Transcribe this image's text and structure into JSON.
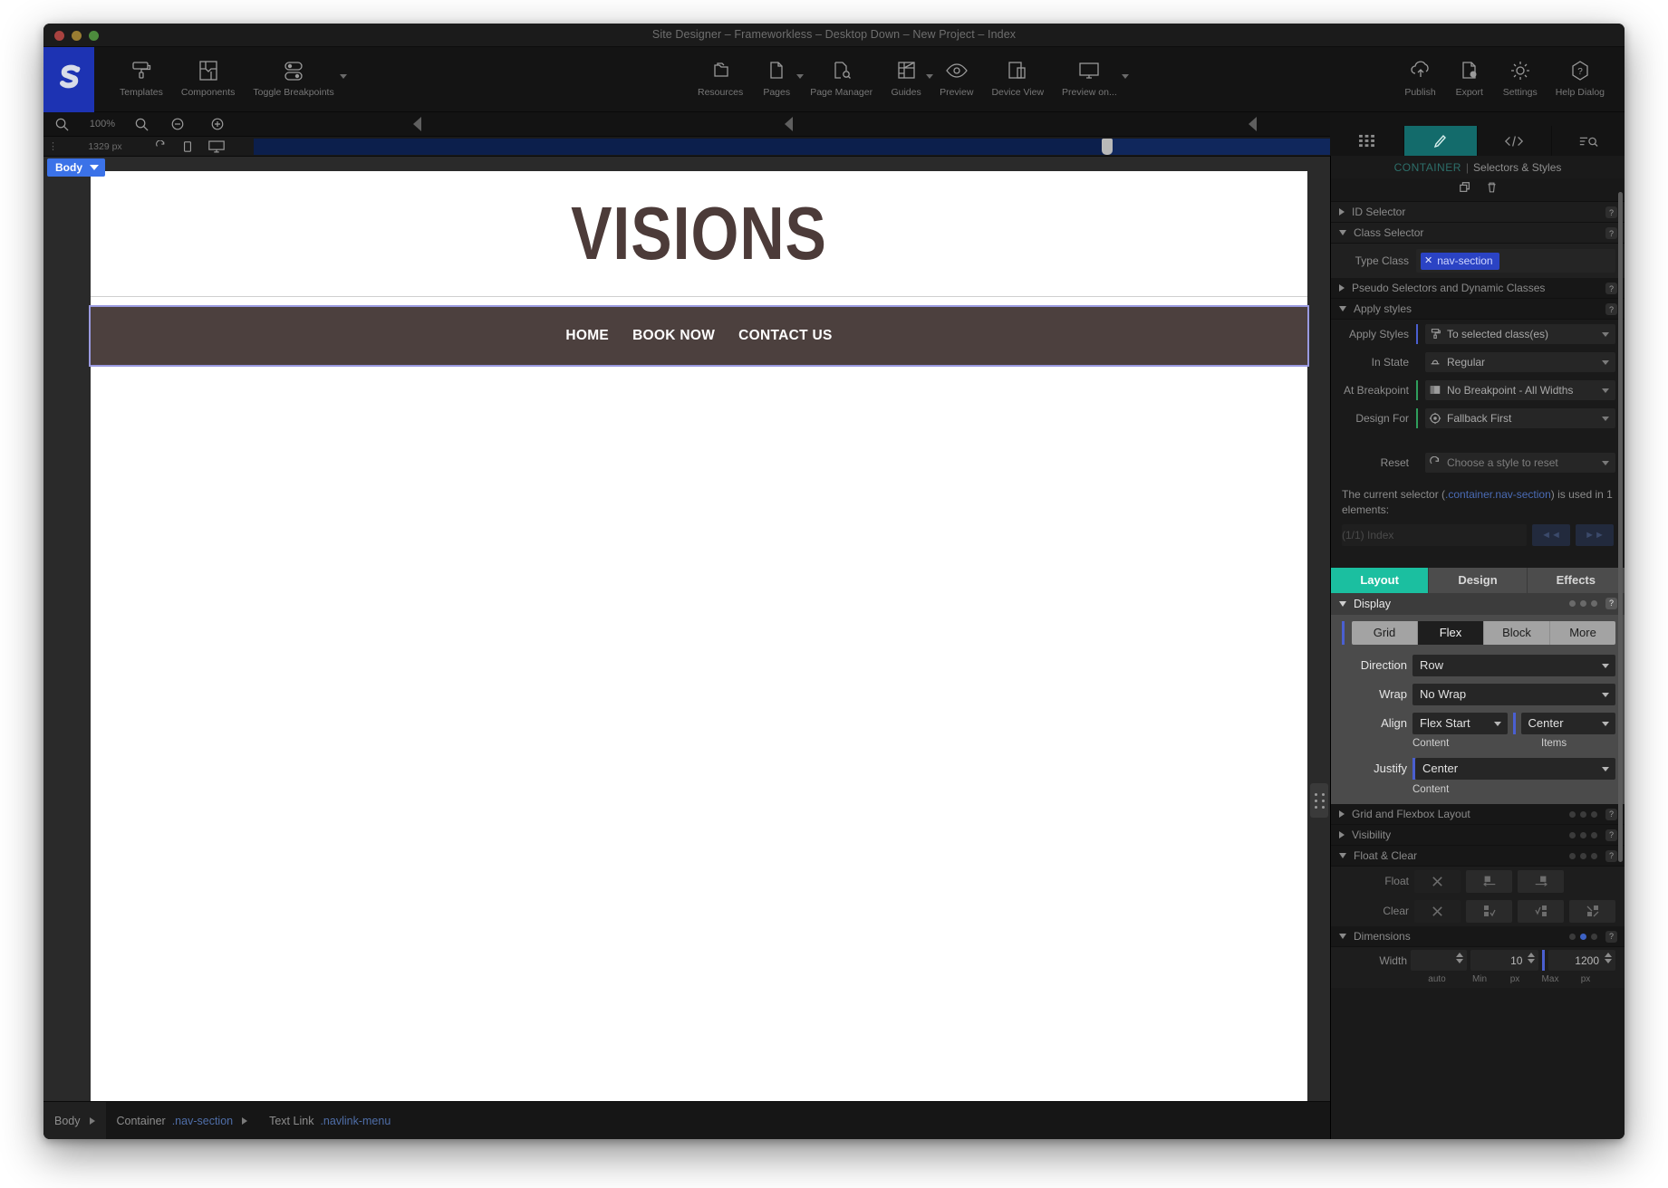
{
  "window": {
    "title": "Site Designer – Frameworkless – Desktop Down – New Project – Index"
  },
  "toolbar": {
    "left": [
      {
        "label": "Templates",
        "icon": "paint-roller-icon",
        "caret": false
      },
      {
        "label": "Components",
        "icon": "components-icon",
        "caret": false
      },
      {
        "label": "Toggle Breakpoints",
        "icon": "toggle-breakpoints-icon",
        "caret": true
      }
    ],
    "center": [
      {
        "label": "Resources",
        "icon": "folders-icon",
        "caret": false
      },
      {
        "label": "Pages",
        "icon": "pages-icon",
        "caret": true
      },
      {
        "label": "Page Manager",
        "icon": "page-manager-icon",
        "caret": false
      },
      {
        "label": "Guides",
        "icon": "guides-icon",
        "caret": true
      },
      {
        "label": "Preview",
        "icon": "eye-icon",
        "caret": false
      },
      {
        "label": "Device View",
        "icon": "device-view-icon",
        "caret": false
      },
      {
        "label": "Preview on...",
        "icon": "monitor-icon",
        "caret": true
      }
    ],
    "right": [
      {
        "label": "Publish",
        "icon": "cloud-upload-icon",
        "caret": false
      },
      {
        "label": "Export",
        "icon": "export-file-icon",
        "caret": false
      },
      {
        "label": "Settings",
        "icon": "gear-icon",
        "caret": false
      },
      {
        "label": "Help Dialog",
        "icon": "help-hexagon-icon",
        "caret": false
      }
    ]
  },
  "zoombar": {
    "zoom_level": "100%",
    "zoom_out_icon": "magnifier-minus-icon",
    "zoom_in_icon": "magnifier-plus-icon",
    "minus_icon": "minus-circle-icon",
    "plus_icon": "plus-circle-icon",
    "collapse_icon": "collapse-left-icon"
  },
  "breakpointbar": {
    "width_value": "1329 px",
    "handle_icon": "breakpoint-handle-icon",
    "icons": [
      "reset-icon",
      "tablet-icon",
      "desktop-icon"
    ]
  },
  "canvas": {
    "body_tag": "Body",
    "hero_title": "VISIONS",
    "nav_links": [
      "HOME",
      "BOOK NOW",
      "CONTACT US"
    ],
    "nav_bg_color": "#4c403e",
    "hero_text_color": "#4c3b39",
    "selection_outline_color": "#9a9ae0"
  },
  "statusbar": {
    "crumbs": [
      {
        "name": "Body",
        "sub": "",
        "selected": true
      },
      {
        "name": "Container",
        "sub": ".nav-section",
        "selected": false
      },
      {
        "name": "Text Link",
        "sub": ".navlink-menu",
        "selected": false
      }
    ]
  },
  "rightpanel": {
    "tabs": [
      {
        "icon": "grid-blocks-icon",
        "active": false
      },
      {
        "icon": "paint-brush-icon",
        "active": true
      },
      {
        "icon": "code-icon",
        "active": false
      },
      {
        "icon": "list-search-icon",
        "active": false
      }
    ],
    "header": {
      "element": "CONTAINER",
      "separator": "|",
      "title": "Selectors & Styles"
    },
    "header_icons": [
      "duplicate-icon",
      "trash-icon"
    ],
    "sections": {
      "id_selector": "ID Selector",
      "class_selector": "Class Selector",
      "type_class_label": "Type Class",
      "type_class_chip": "nav-section",
      "pseudo_selectors": "Pseudo Selectors and Dynamic Classes",
      "apply_styles": "Apply styles"
    },
    "apply": [
      {
        "label": "Apply Styles",
        "value": "To selected class(es)",
        "icon": "roller-icon",
        "bar": "blue"
      },
      {
        "label": "In State",
        "value": "Regular",
        "icon": "state-icon",
        "bar": "none"
      },
      {
        "label": "At Breakpoint",
        "value": "No Breakpoint - All Widths",
        "icon": "breakpoint-icon",
        "bar": "green"
      },
      {
        "label": "Design For",
        "value": "Fallback First",
        "icon": "target-icon",
        "bar": "green"
      }
    ],
    "reset": {
      "label": "Reset",
      "placeholder": "Choose a style to reset",
      "icon": "reset-circle-icon"
    },
    "usage": {
      "text_before": "The current selector (",
      "selector": ".container.nav-section",
      "text_after": ") is used in 1 elements:",
      "dropdown_value": "(1/1) Index",
      "prev_label": "◄◄",
      "next_label": "►►"
    },
    "lde_tabs": [
      {
        "label": "Layout",
        "active": true
      },
      {
        "label": "Design",
        "active": false
      },
      {
        "label": "Effects",
        "active": false
      }
    ],
    "display": {
      "title": "Display",
      "segments": [
        {
          "label": "Grid",
          "active": false
        },
        {
          "label": "Flex",
          "active": true
        },
        {
          "label": "Block",
          "active": false
        },
        {
          "label": "More",
          "active": false
        }
      ],
      "direction": {
        "label": "Direction",
        "value": "Row"
      },
      "wrap": {
        "label": "Wrap",
        "value": "No Wrap"
      },
      "align": {
        "label": "Align",
        "value_content": "Flex Start",
        "value_items": "Center",
        "sub_content": "Content",
        "sub_items": "Items"
      },
      "justify": {
        "label": "Justify",
        "value": "Center",
        "sub": "Content"
      }
    },
    "more_sections": [
      {
        "label": "Grid and Flexbox Layout",
        "open": false
      },
      {
        "label": "Visibility",
        "open": false
      },
      {
        "label": "Float & Clear",
        "open": true
      }
    ],
    "float_clear": {
      "float_label": "Float",
      "clear_label": "Clear",
      "float_icons": [
        "none-x-icon",
        "float-left-icon",
        "float-right-icon"
      ],
      "clear_icons": [
        "none-x-icon",
        "clear-left-icon",
        "clear-right-icon",
        "clear-both-icon"
      ]
    },
    "dimensions": {
      "title": "Dimensions",
      "width_label": "Width",
      "width_value": "",
      "min_value": "10",
      "max_value": "1200",
      "sub_auto": "auto",
      "sub_min": "Min",
      "sub_min_unit": "px",
      "sub_max": "Max",
      "sub_max_unit": "px"
    }
  }
}
